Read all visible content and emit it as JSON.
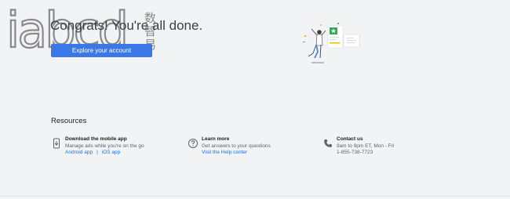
{
  "logo": {
    "text": "iabcd",
    "cjk": [
      "数",
      "智",
      "易"
    ]
  },
  "main": {
    "headline": "Congrats! You're all done.",
    "cta_label": "Explore your account"
  },
  "resources": {
    "title": "Resources",
    "items": [
      {
        "icon": "phone-download-icon",
        "title": "Download the mobile app",
        "desc": "Manage ads while you're on the go",
        "links": [
          "Android app",
          "iOS app"
        ],
        "separator": "|"
      },
      {
        "icon": "help-circle-icon",
        "title": "Learn more",
        "desc": "Get answers to your questions",
        "links": [
          "Visit the Help center"
        ]
      },
      {
        "icon": "phone-icon",
        "title": "Contact us",
        "desc": "9am to 9pm ET, Mon - Fri",
        "desc2": "1-855-738-7723"
      }
    ]
  },
  "colors": {
    "accent": "#3b78e7",
    "link": "#1a73e8",
    "background": "#f1f3f4"
  }
}
